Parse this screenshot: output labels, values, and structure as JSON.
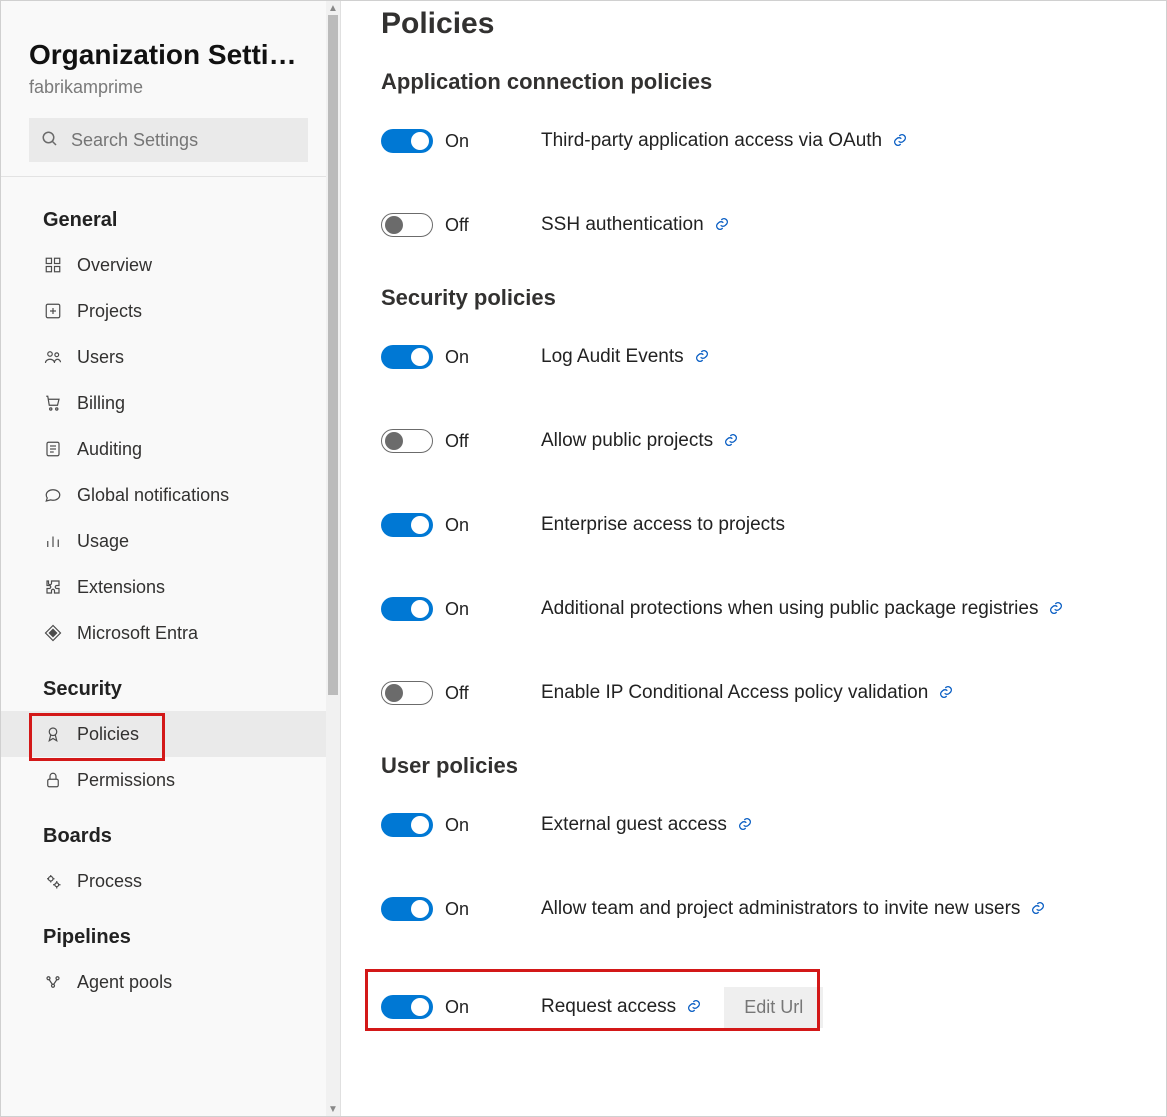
{
  "sidebar": {
    "title": "Organization Settin…",
    "subtitle": "fabrikamprime",
    "search_placeholder": "Search Settings",
    "groups": [
      {
        "label": "General",
        "items": [
          {
            "id": "overview",
            "label": "Overview",
            "icon": "grid-icon"
          },
          {
            "id": "projects",
            "label": "Projects",
            "icon": "plus-box-icon"
          },
          {
            "id": "users",
            "label": "Users",
            "icon": "users-icon"
          },
          {
            "id": "billing",
            "label": "Billing",
            "icon": "cart-icon"
          },
          {
            "id": "auditing",
            "label": "Auditing",
            "icon": "list-icon"
          },
          {
            "id": "global-notifications",
            "label": "Global notifications",
            "icon": "chat-icon"
          },
          {
            "id": "usage",
            "label": "Usage",
            "icon": "bar-chart-icon"
          },
          {
            "id": "extensions",
            "label": "Extensions",
            "icon": "puzzle-icon"
          },
          {
            "id": "microsoft-entra",
            "label": "Microsoft Entra",
            "icon": "entra-icon"
          }
        ]
      },
      {
        "label": "Security",
        "items": [
          {
            "id": "policies",
            "label": "Policies",
            "icon": "ribbon-icon",
            "active": true,
            "highlight": true
          },
          {
            "id": "permissions",
            "label": "Permissions",
            "icon": "lock-icon"
          }
        ]
      },
      {
        "label": "Boards",
        "items": [
          {
            "id": "process",
            "label": "Process",
            "icon": "gears-icon"
          }
        ]
      },
      {
        "label": "Pipelines",
        "items": [
          {
            "id": "agent-pools",
            "label": "Agent pools",
            "icon": "pools-icon"
          }
        ]
      }
    ]
  },
  "main": {
    "title": "Policies",
    "sections": [
      {
        "title": "Application connection policies",
        "policies": [
          {
            "id": "oauth",
            "on": true,
            "state": "On",
            "label": "Third-party application access via OAuth",
            "link": true
          },
          {
            "id": "ssh",
            "on": false,
            "state": "Off",
            "label": "SSH authentication",
            "link": true
          }
        ]
      },
      {
        "title": "Security policies",
        "policies": [
          {
            "id": "audit",
            "on": true,
            "state": "On",
            "label": "Log Audit Events",
            "link": true
          },
          {
            "id": "public-projects",
            "on": false,
            "state": "Off",
            "label": "Allow public projects",
            "link": true
          },
          {
            "id": "enterprise-access",
            "on": true,
            "state": "On",
            "label": "Enterprise access to projects",
            "link": false
          },
          {
            "id": "package-protections",
            "on": true,
            "state": "On",
            "label": "Additional protections when using public package registries",
            "link": true
          },
          {
            "id": "ip-conditional",
            "on": false,
            "state": "Off",
            "label": "Enable IP Conditional Access policy validation",
            "link": true
          }
        ]
      },
      {
        "title": "User policies",
        "policies": [
          {
            "id": "guest-access",
            "on": true,
            "state": "On",
            "label": "External guest access",
            "link": true
          },
          {
            "id": "invite-users",
            "on": true,
            "state": "On",
            "label": "Allow team and project administrators to invite new users",
            "link": true
          },
          {
            "id": "request-access",
            "on": true,
            "state": "On",
            "label": "Request access",
            "link": true,
            "edit_button": "Edit Url",
            "highlight": true
          }
        ]
      }
    ]
  }
}
